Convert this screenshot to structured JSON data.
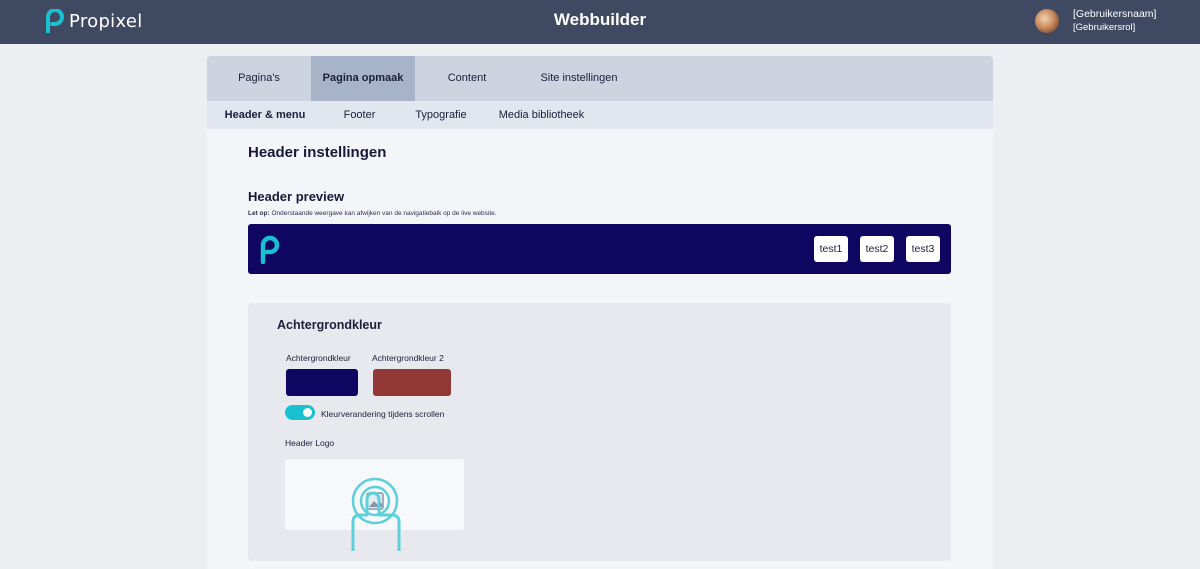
{
  "topbar": {
    "brand_name": "Propixel",
    "app_title": "Webbuilder",
    "user_name": "[Gebruikersnaam]",
    "user_role": "[Gebruikersrol]"
  },
  "tabs": [
    {
      "label": "Pagina's",
      "active": false
    },
    {
      "label": "Pagina opmaak",
      "active": true
    },
    {
      "label": "Content",
      "active": false
    },
    {
      "label": "Site instellingen",
      "active": false
    }
  ],
  "subtabs": [
    {
      "label": "Header & menu",
      "active": true
    },
    {
      "label": "Footer",
      "active": false
    },
    {
      "label": "Typografie",
      "active": false
    },
    {
      "label": "Media bibliotheek",
      "active": false
    }
  ],
  "main": {
    "title": "Header instellingen",
    "preview_heading": "Header preview",
    "note_bold": "Let op:",
    "note_text": "Onderstaande weergave kan afwijken van de navigatiebalk op de live website.",
    "preview_buttons": [
      "test1",
      "test2",
      "test3"
    ]
  },
  "background_section": {
    "title": "Achtergrondkleur",
    "color1_label": "Achtergrondkleur",
    "color2_label": "Achtergrondkleur 2",
    "color1": "#0e0660",
    "color2": "#923836",
    "toggle_label": "Kleurverandering tijdens scrollen",
    "toggle_on": true,
    "logo_label": "Header Logo"
  },
  "colors": {
    "topbar": "#3f4a62",
    "accent": "#19c0d0",
    "preview_bg": "#0e0660"
  }
}
